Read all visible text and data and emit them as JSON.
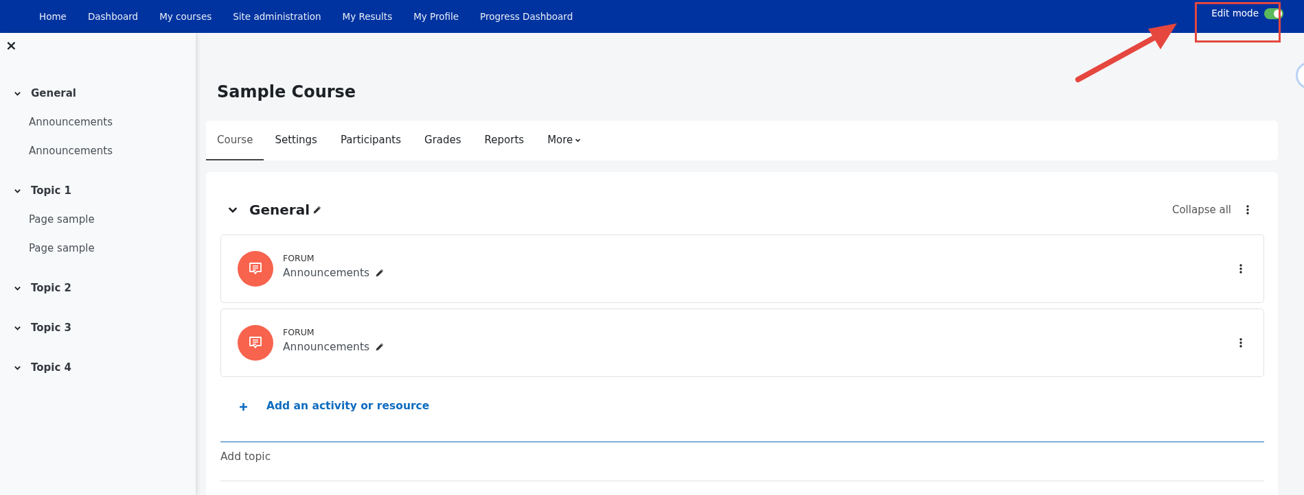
{
  "navbar": {
    "items": [
      "Home",
      "Dashboard",
      "My courses",
      "Site administration",
      "My Results",
      "My Profile",
      "Progress Dashboard"
    ],
    "edit_mode": {
      "label": "Edit mode",
      "on": true
    }
  },
  "sidebar": {
    "close": "×",
    "sections": [
      {
        "title": "General",
        "expanded": true,
        "children": [
          {
            "title": "Announcements"
          },
          {
            "title": "Announcements"
          }
        ]
      },
      {
        "title": "Topic 1",
        "expanded": true,
        "children": [
          {
            "title": "Page sample"
          },
          {
            "title": "Page sample"
          }
        ]
      },
      {
        "title": "Topic 2",
        "expanded": true
      },
      {
        "title": "Topic 3",
        "expanded": true
      },
      {
        "title": "Topic 4",
        "expanded": true
      }
    ]
  },
  "course_title": "Sample Course",
  "tabs": [
    {
      "label": "Course",
      "selected": true
    },
    {
      "label": "Settings",
      "selected": false
    },
    {
      "label": "Participants",
      "selected": false
    },
    {
      "label": "Grades",
      "selected": false
    },
    {
      "label": "Reports",
      "selected": false
    },
    {
      "label": "More",
      "selected": false,
      "dropdown": true
    }
  ],
  "section": {
    "title": "General",
    "expanded": true,
    "collapse_label": "Collapse all",
    "activities": [
      {
        "type": "FORUM",
        "name": "Announcements"
      },
      {
        "type": "FORUM",
        "name": "Announcements"
      }
    ],
    "add_activity": "Add an activity or resource",
    "add_topic": "Add topic"
  }
}
